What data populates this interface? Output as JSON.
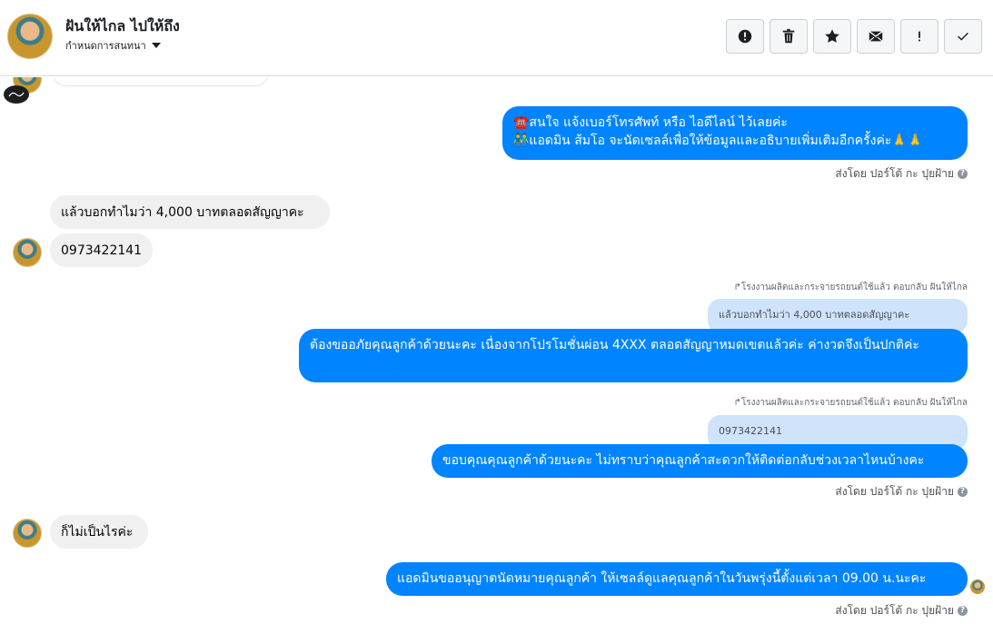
{
  "header": {
    "title": "ฝันให้ไกล ไปให้ถึง",
    "subtitle": "กำหนดการสนทนา"
  },
  "toolbar": [
    {
      "name": "report-button",
      "icon": "alert-circle-icon"
    },
    {
      "name": "delete-button",
      "icon": "trash-icon"
    },
    {
      "name": "star-button",
      "icon": "star-icon"
    },
    {
      "name": "mail-button",
      "icon": "envelope-icon"
    },
    {
      "name": "spam-button",
      "icon": "exclamation-icon"
    },
    {
      "name": "done-button",
      "icon": "check-icon"
    }
  ],
  "messages": {
    "m1_line1": "☎️สนใจ แจ้งเบอร์โทรศัพท์ หรือ ไอดีไลน์  ไว้เลยค่ะ",
    "m1_line2": "👬แอดมิน ส้มโอ จะนัดเซลล์เพื่อให้ข้อมูลและอธิบายเพิ่มเติมอีกครั้งค่ะ🙏🙏",
    "sent_by": "ส่งโดย ปอร์โต้ กะ ปุยฝ้าย",
    "m2": "แล้วบอกทำไมว่า 4,000 บาทตลอดสัญญาคะ",
    "m3": "0973422141",
    "reply_meta": "โรงงานผลิตและกระจายรถยนต์ใช้แล้ว ตอบกลับ ฝันให้ไกล",
    "q1": "แล้วบอกทำไมว่า 4,000 บาทตลอดสัญญาคะ",
    "m4": "ต้องขออภัยคุณลูกค้าด้วยนะคะ เนื่องจากโปรโมชั่นผ่อน 4XXX ตลอดสัญญาหมดเขตแล้วค่ะ ค่างวดจึงเป็นปกติค่ะ",
    "q2": "0973422141",
    "m5": "ขอบคุณคุณลูกค้าด้วยนะคะ ไม่ทราบว่าคุณลูกค้าสะดวกให้ติดต่อกลับช่วงเวลาไหนบ้างคะ",
    "m6": "ก็ไม่เป็นไรค่ะ",
    "m7": "แอดมินขออนุญาตนัดหมายคุณลูกค้า ให้เซลล์ดูแลคุณลูกค้าในวันพรุ่งนี้ตั้งแต่เวลา 09.00 น.นะคะ"
  },
  "colors": {
    "outgoing": "#0084ff",
    "incoming": "#f1f0f0",
    "quoted": "#cfe3fb"
  }
}
